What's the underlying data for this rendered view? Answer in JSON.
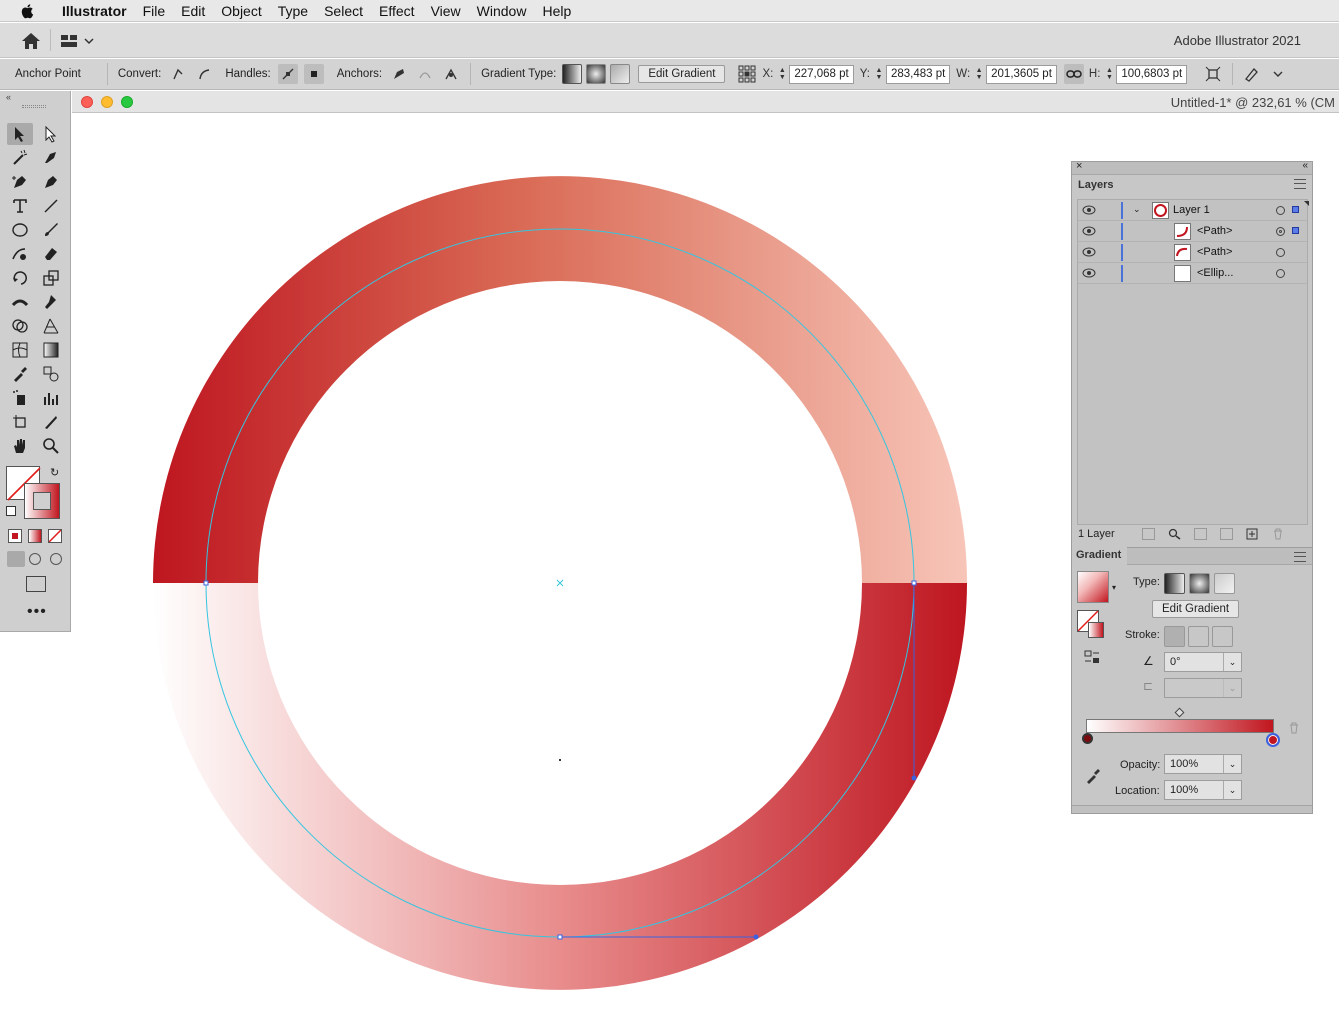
{
  "menubar": {
    "app": "Illustrator",
    "items": [
      "File",
      "Edit",
      "Object",
      "Type",
      "Select",
      "Effect",
      "View",
      "Window",
      "Help"
    ]
  },
  "homebar": {
    "version": "Adobe Illustrator 2021"
  },
  "controlbar": {
    "mode_label": "Anchor Point",
    "convert_label": "Convert:",
    "handles_label": "Handles:",
    "anchors_label": "Anchors:",
    "gradient_type_label": "Gradient Type:",
    "edit_gradient": "Edit Gradient",
    "x_label": "X:",
    "x_value": "227,068 pt",
    "y_label": "Y:",
    "y_value": "283,483 pt",
    "w_label": "W:",
    "w_value": "201,3605 pt",
    "h_label": "H:",
    "h_value": "100,6803 pt"
  },
  "document": {
    "title": "Untitled-1* @ 232,61 % (CM"
  },
  "layers": {
    "tab": "Layers",
    "rows": [
      {
        "label": "Layer 1"
      },
      {
        "label": "<Path>"
      },
      {
        "label": "<Path>"
      },
      {
        "label": "<Ellip..."
      }
    ],
    "count": "1 Layer"
  },
  "gradient": {
    "tab": "Gradient",
    "type_label": "Type:",
    "edit_gradient": "Edit Gradient",
    "stroke_label": "Stroke:",
    "angle_value": "0°",
    "opacity_label": "Opacity:",
    "opacity_value": "100%",
    "location_label": "Location:",
    "location_value": "100%",
    "start_color": "#ffffff",
    "end_color": "#c1161f"
  },
  "colors": {
    "accent_red": "#c1161f",
    "selection_cyan": "#35c5e0",
    "selection_blue": "#3b63e0"
  },
  "icons": [
    "apple-icon",
    "home-icon",
    "workspace-icon",
    "selection-tool-icon",
    "direct-selection-tool-icon",
    "pen-tool-icon",
    "type-tool-icon",
    "line-tool-icon",
    "ellipse-tool-icon",
    "paintbrush-tool-icon",
    "hand-tool-icon",
    "zoom-tool-icon",
    "eye-icon",
    "eyedropper-icon",
    "trash-icon"
  ]
}
